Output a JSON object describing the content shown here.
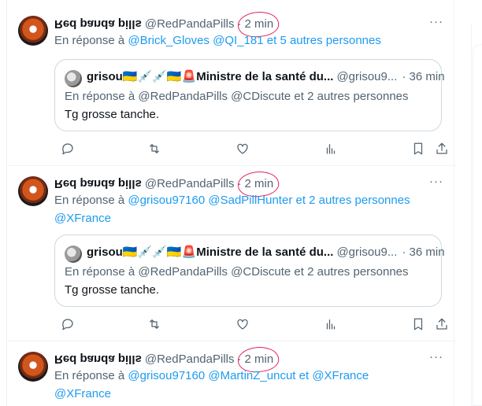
{
  "tweets": [
    {
      "name": "Red panda pills",
      "handle": "@RedPandaPills",
      "time": "2 min",
      "reply_prefix": "En réponse à ",
      "reply_mentions": "@Brick_Gloves @QI_181",
      "reply_suffix": " et 5 autres personnes",
      "quote": {
        "name": "grisou🇺🇦💉💉🇺🇦🚨Ministre de la santé du...",
        "handle": "@grisou9...",
        "time": "· 36 min",
        "reply": "En réponse à @RedPandaPills @CDiscute  et 2 autres personnes",
        "text": "Tg grosse tanche."
      }
    },
    {
      "name": "Red panda pills",
      "handle": "@RedPandaPills",
      "time": "2 min",
      "reply_prefix": "En réponse à ",
      "reply_mentions": "@grisou97160 @SadPillHunter",
      "reply_suffix": "  et 2 autres personnes",
      "reply_line2": "@XFrance",
      "quote": {
        "name": "grisou🇺🇦💉💉🇺🇦🚨Ministre de la santé du...",
        "handle": "@grisou9...",
        "time": "· 36 min",
        "reply": "En réponse à @RedPandaPills @CDiscute  et 2 autres personnes",
        "text": "Tg grosse tanche."
      }
    },
    {
      "name": "Red panda pills",
      "handle": "@RedPandaPills",
      "time": "2 min",
      "reply_prefix": "En réponse à ",
      "reply_mentions": "@grisou97160 @MartinZ_uncut",
      "reply_suffix": "  et  ",
      "reply_mention_end": "@XFrance",
      "reply_line2": "@XFrance"
    }
  ],
  "separator": "·",
  "more_glyph": "···",
  "colors": {
    "accent": "#1d9bf0",
    "muted": "#536471",
    "annotation": "#e0245e"
  },
  "icons": [
    "reply-icon",
    "retweet-icon",
    "like-icon",
    "views-icon",
    "bookmark-icon",
    "share-icon"
  ]
}
